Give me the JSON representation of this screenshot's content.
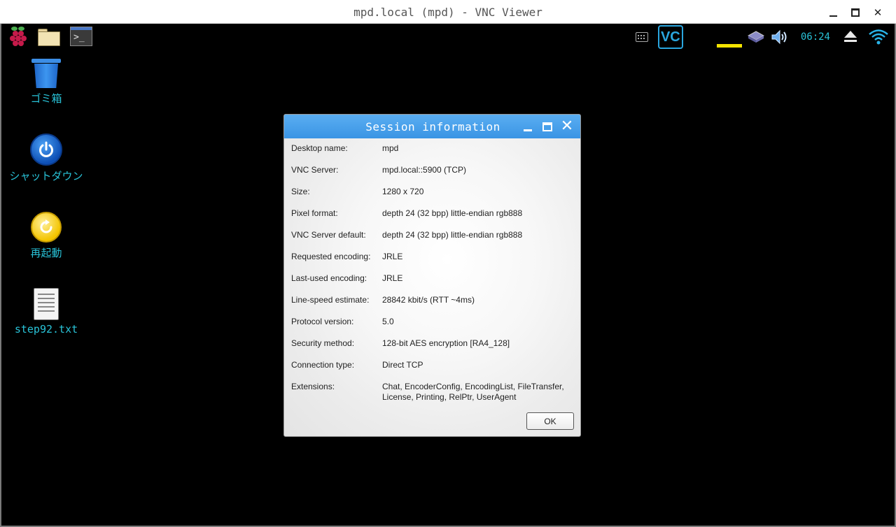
{
  "viewer": {
    "title": "mpd.local (mpd) - VNC Viewer",
    "close_glyph": "✕"
  },
  "taskbar": {
    "left_icons": [
      "raspberry-pi-menu-icon",
      "file-manager-icon",
      "terminal-icon"
    ],
    "terminal_prompt": ">_",
    "tray_icons": [
      "keyboard-icon",
      "vnc-icon",
      "cpu-monitor-icon",
      "network-icon",
      "volume-icon",
      "eject-icon",
      "wifi-icon"
    ],
    "vnc_logo": "VC",
    "clock": "06:24",
    "colors": {
      "clock": "#29c3d8",
      "cpu_bar": "#f5e400",
      "vnc": "#2aa6df"
    }
  },
  "desktop": {
    "icons": [
      {
        "label": "ゴミ箱",
        "icon": "trash-icon"
      },
      {
        "label": "シャットダウン",
        "icon": "power-icon"
      },
      {
        "label": "再起動",
        "icon": "reboot-icon"
      },
      {
        "label": "step92.txt",
        "icon": "text-file-icon"
      }
    ],
    "colors": {
      "background": "#000000",
      "icon_label": "#29c3d8"
    }
  },
  "dialog": {
    "title": "Session information",
    "close_glyph": "✕",
    "rows": [
      {
        "key": "Desktop name:",
        "value": "mpd"
      },
      {
        "key": "VNC Server:",
        "value": "mpd.local::5900 (TCP)"
      },
      {
        "key": "Size:",
        "value": "1280 x 720"
      },
      {
        "key": "Pixel format:",
        "value": "depth 24 (32 bpp) little-endian rgb888"
      },
      {
        "key": "VNC Server default:",
        "value": "depth 24 (32 bpp) little-endian rgb888"
      },
      {
        "key": "Requested encoding:",
        "value": "JRLE"
      },
      {
        "key": "Last-used encoding:",
        "value": "JRLE"
      },
      {
        "key": "Line-speed estimate:",
        "value": "28842 kbit/s (RTT ~4ms)"
      },
      {
        "key": "Protocol version:",
        "value": "5.0"
      },
      {
        "key": "Security method:",
        "value": "128-bit AES encryption [RA4_128]"
      },
      {
        "key": "Connection type:",
        "value": "Direct TCP"
      },
      {
        "key": "Extensions:",
        "value": "Chat, EncoderConfig, EncodingList, FileTransfer, License, Printing, RelPtr, UserAgent"
      }
    ],
    "ok_label": "OK",
    "colors": {
      "titlebar": "#3a94e4"
    }
  }
}
